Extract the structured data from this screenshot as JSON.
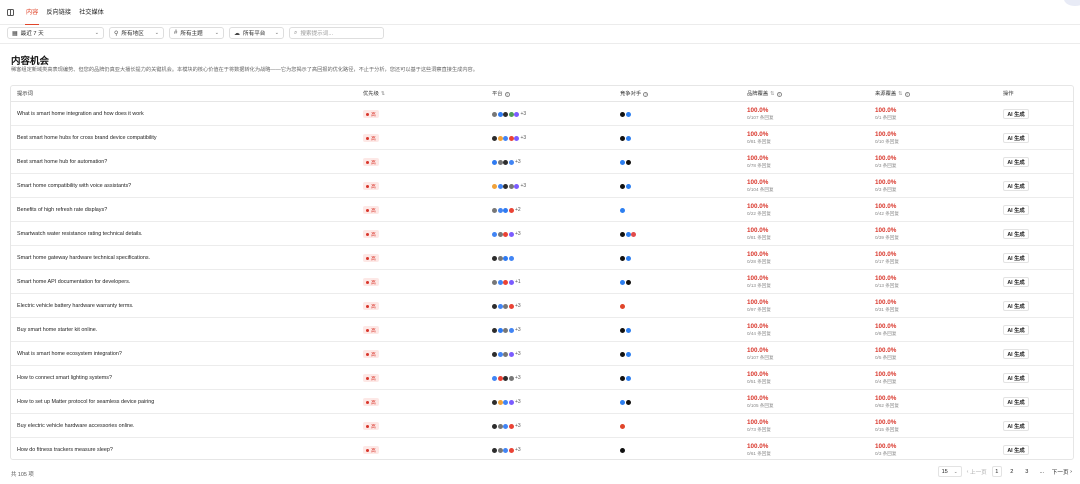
{
  "tabs": [
    {
      "label": "内容",
      "active": true
    },
    {
      "label": "反向链接",
      "active": false
    },
    {
      "label": "社交媒体",
      "active": false
    }
  ],
  "filters": {
    "date": "最近 7 天",
    "region": "所有地区",
    "topic": "所有主题",
    "platform": "所有平台",
    "search_placeholder": "搜索提示词..."
  },
  "page": {
    "title": "内容机会",
    "description": "稀客组定新域类高表现编势、但您的品牌仍真亚大播长提力的关键机会。本模块的核心价值在于将数据转化为战略——它为您揭示了高回报的优化路径，不止于分析，您还可以基于这些洞察直接生成内容。"
  },
  "table": {
    "headers": {
      "prompt": "提示词",
      "priority": "优先级",
      "platform": "平台",
      "competitors": "竞争对手",
      "brand_gap": "品牌覆盖",
      "source_gap": "来源覆盖",
      "action": "操作"
    },
    "rows": [
      {
        "prompt": "What is smart home integration and how does it work",
        "priority": "高",
        "platforms": [
          "#777777",
          "#2f7bf1",
          "#2d2d2d",
          "#4f9c5a",
          "#7b5cff"
        ],
        "more": "+3",
        "competitors": [
          "#111111",
          "#2d7ff0"
        ],
        "brand_pct": "100.0%",
        "brand_sub": "0/107 条回复",
        "src_pct": "100.0%",
        "src_sub": "0/1 条回复",
        "action": "AI 生成"
      },
      {
        "prompt": "Best smart home hubs for cross brand device compatibility",
        "priority": "高",
        "platforms": [
          "#2d2d2d",
          "#f0a23a",
          "#4285f4",
          "#ea4335",
          "#7b5cff"
        ],
        "more": "+3",
        "competitors": [
          "#111111",
          "#2d7ff0"
        ],
        "brand_pct": "100.0%",
        "brand_sub": "0/81 条回复",
        "src_pct": "100.0%",
        "src_sub": "0/10 条回复",
        "action": "AI 生成"
      },
      {
        "prompt": "Best smart home hub for automation?",
        "priority": "高",
        "platforms": [
          "#2f7bf1",
          "#777777",
          "#2d2d2d",
          "#4285f4"
        ],
        "more": "+3",
        "competitors": [
          "#2d7ff0",
          "#111111"
        ],
        "brand_pct": "100.0%",
        "brand_sub": "0/78 条回复",
        "src_pct": "100.0%",
        "src_sub": "0/3 条回复",
        "action": "AI 生成"
      },
      {
        "prompt": "Smart home compatibility with voice assistants?",
        "priority": "高",
        "platforms": [
          "#f0a23a",
          "#4285f4",
          "#2d2d2d",
          "#777777",
          "#7b5cff"
        ],
        "more": "+3",
        "competitors": [
          "#111111",
          "#2d7ff0"
        ],
        "brand_pct": "100.0%",
        "brand_sub": "0/104 条回复",
        "src_pct": "100.0%",
        "src_sub": "0/3 条回复",
        "action": "AI 生成"
      },
      {
        "prompt": "Benefits of high refresh rate displays?",
        "priority": "高",
        "platforms": [
          "#777777",
          "#4285f4",
          "#2f7bf1",
          "#ea4335"
        ],
        "more": "+2",
        "competitors": [
          "#2d7ff0"
        ],
        "brand_pct": "100.0%",
        "brand_sub": "0/22 条回复",
        "src_pct": "100.0%",
        "src_sub": "0/42 条回复",
        "action": "AI 生成"
      },
      {
        "prompt": "Smartwatch water resistance rating technical details.",
        "priority": "高",
        "platforms": [
          "#4285f4",
          "#777777",
          "#ea4335",
          "#7b5cff"
        ],
        "more": "+3",
        "competitors": [
          "#111111",
          "#2d7ff0",
          "#e24b4b"
        ],
        "brand_pct": "100.0%",
        "brand_sub": "0/81 条回复",
        "src_pct": "100.0%",
        "src_sub": "0/39 条回复",
        "action": "AI 生成"
      },
      {
        "prompt": "Smart home gateway hardware technical specifications.",
        "priority": "高",
        "platforms": [
          "#2d2d2d",
          "#777777",
          "#2f7bf1",
          "#4285f4"
        ],
        "more": "",
        "competitors": [
          "#111111",
          "#2d7ff0"
        ],
        "brand_pct": "100.0%",
        "brand_sub": "0/28 条回复",
        "src_pct": "100.0%",
        "src_sub": "0/17 条回复",
        "action": "AI 生成"
      },
      {
        "prompt": "Smart home API documentation for developers.",
        "priority": "高",
        "platforms": [
          "#777777",
          "#4285f4",
          "#ea4335",
          "#7b5cff"
        ],
        "more": "+1",
        "competitors": [
          "#2d7ff0",
          "#111111"
        ],
        "brand_pct": "100.0%",
        "brand_sub": "0/13 条回复",
        "src_pct": "100.0%",
        "src_sub": "0/13 条回复",
        "action": "AI 生成"
      },
      {
        "prompt": "Electric vehicle battery hardware warranty terms.",
        "priority": "高",
        "platforms": [
          "#2d2d2d",
          "#4285f4",
          "#777777",
          "#ea4335"
        ],
        "more": "+3",
        "competitors": [
          "#e0452a"
        ],
        "brand_pct": "100.0%",
        "brand_sub": "0/97 条回复",
        "src_pct": "100.0%",
        "src_sub": "0/31 条回复",
        "action": "AI 生成"
      },
      {
        "prompt": "Buy smart home starter kit online.",
        "priority": "高",
        "platforms": [
          "#2d2d2d",
          "#2f7bf1",
          "#777777",
          "#4285f4"
        ],
        "more": "+3",
        "competitors": [
          "#111111",
          "#2d7ff0"
        ],
        "brand_pct": "100.0%",
        "brand_sub": "0/44 条回复",
        "src_pct": "100.0%",
        "src_sub": "0/8 条回复",
        "action": "AI 生成"
      },
      {
        "prompt": "What is smart home ecosystem integration?",
        "priority": "高",
        "platforms": [
          "#2d2d2d",
          "#4285f4",
          "#777777",
          "#7b5cff"
        ],
        "more": "+3",
        "competitors": [
          "#111111",
          "#2d7ff0"
        ],
        "brand_pct": "100.0%",
        "brand_sub": "0/107 条回复",
        "src_pct": "100.0%",
        "src_sub": "0/5 条回复",
        "action": "AI 生成"
      },
      {
        "prompt": "How to connect smart lighting systems?",
        "priority": "高",
        "platforms": [
          "#4285f4",
          "#ea4335",
          "#2d2d2d",
          "#777777"
        ],
        "more": "+3",
        "competitors": [
          "#111111",
          "#2d7ff0"
        ],
        "brand_pct": "100.0%",
        "brand_sub": "0/51 条回复",
        "src_pct": "100.0%",
        "src_sub": "0/4 条回复",
        "action": "AI 生成"
      },
      {
        "prompt": "How to set up Matter protocol for seamless device pairing",
        "priority": "高",
        "platforms": [
          "#2d2d2d",
          "#f0a23a",
          "#4285f4",
          "#7b5cff"
        ],
        "more": "+3",
        "competitors": [
          "#2d7ff0",
          "#111111"
        ],
        "brand_pct": "100.0%",
        "brand_sub": "0/105 条回复",
        "src_pct": "100.0%",
        "src_sub": "0/62 条回复",
        "action": "AI 生成"
      },
      {
        "prompt": "Buy electric vehicle hardware accessories online.",
        "priority": "高",
        "platforms": [
          "#2d2d2d",
          "#777777",
          "#4285f4",
          "#ea4335"
        ],
        "more": "+3",
        "competitors": [
          "#e0452a"
        ],
        "brand_pct": "100.0%",
        "brand_sub": "0/73 条回复",
        "src_pct": "100.0%",
        "src_sub": "0/15 条回复",
        "action": "AI 生成"
      },
      {
        "prompt": "How do fitness trackers measure sleep?",
        "priority": "高",
        "platforms": [
          "#2d2d2d",
          "#777777",
          "#4285f4",
          "#ea4335"
        ],
        "more": "+3",
        "competitors": [
          "#111111"
        ],
        "brand_pct": "100.0%",
        "brand_sub": "0/61 条回复",
        "src_pct": "100.0%",
        "src_sub": "0/3 条回复",
        "action": "AI 生成"
      }
    ]
  },
  "footer": {
    "total": "共 105 项",
    "page_size": "15",
    "prev": "上一页",
    "pages": [
      "1",
      "2",
      "3",
      "..."
    ],
    "next": "下一页"
  }
}
